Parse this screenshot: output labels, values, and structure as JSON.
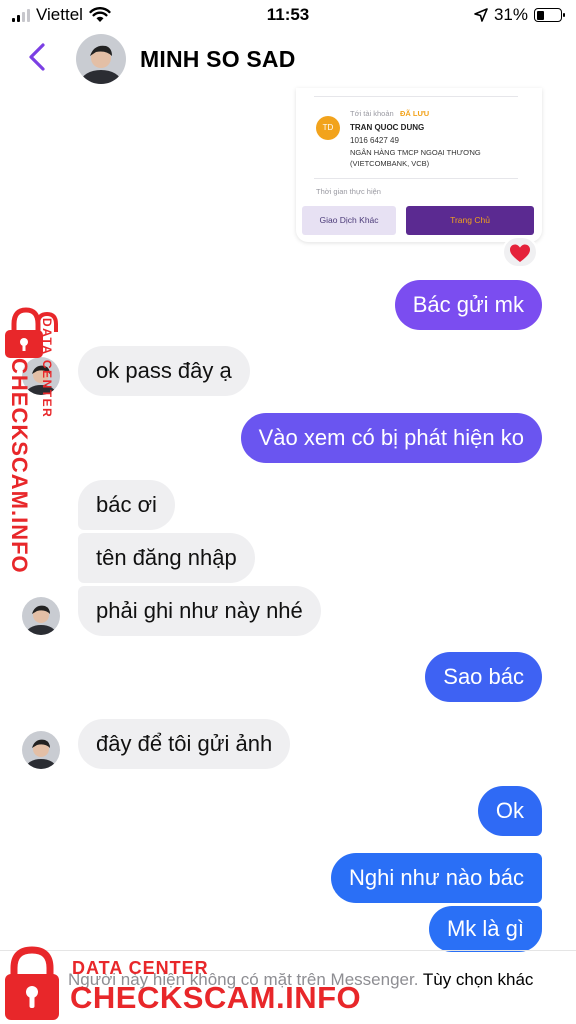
{
  "status_bar": {
    "carrier": "Viettel",
    "time": "11:53",
    "battery": "31%",
    "battery_level": 0.31,
    "icons": [
      "signal-icon",
      "wifi-icon",
      "location-arrow-icon",
      "battery-icon"
    ]
  },
  "header": {
    "name": "MINH SO SAD",
    "back_icon": "chevron-left-icon",
    "accent_color": "#7b3fe4"
  },
  "receipt": {
    "account_label": "Tới tài khoản",
    "saved_badge": "ĐÃ LƯU",
    "avatar_initials": "TD",
    "account_name": "TRAN QUOC DUNG",
    "account_number": "1016 6427 49",
    "bank_line1": "NGÂN HÀNG TMCP NGOẠI THƯƠNG",
    "bank_line2": "(VIETCOMBANK, VCB)",
    "time_label": "Thời gian thực hiện",
    "button_other": "Giao Dịch Khác",
    "button_home": "Trang Chủ",
    "reaction": "❤️"
  },
  "messages": [
    {
      "side": "out",
      "text": "Bác gửi mk",
      "color": "#7b4df0"
    },
    {
      "side": "in",
      "text": "ok pass đây ạ"
    },
    {
      "side": "out",
      "text": "Vào xem có bị phát hiện ko",
      "color": "#6a55f0"
    },
    {
      "side": "in",
      "text": "bác ơi"
    },
    {
      "side": "in",
      "text": "tên đăng nhập"
    },
    {
      "side": "in",
      "text": "phải ghi như này nhé"
    },
    {
      "side": "out",
      "text": "Sao bác",
      "color": "#3e62f3"
    },
    {
      "side": "in",
      "text": "đây để tôi gửi ảnh"
    },
    {
      "side": "out",
      "text": "Ok",
      "color": "#2f6af5"
    },
    {
      "side": "out",
      "text": "Nghi như nào bác",
      "color": "#2a6ff6"
    },
    {
      "side": "out",
      "text": "Mk là gì",
      "color": "#2a70f6"
    }
  ],
  "footer": {
    "notice": "Người này hiện không có mặt trên Messenger.",
    "options_link": "Tùy chọn khác"
  },
  "watermark": {
    "line1": "DATA CENTER",
    "line2": "CHECKSCAM.INFO",
    "color": "#e8272a"
  }
}
